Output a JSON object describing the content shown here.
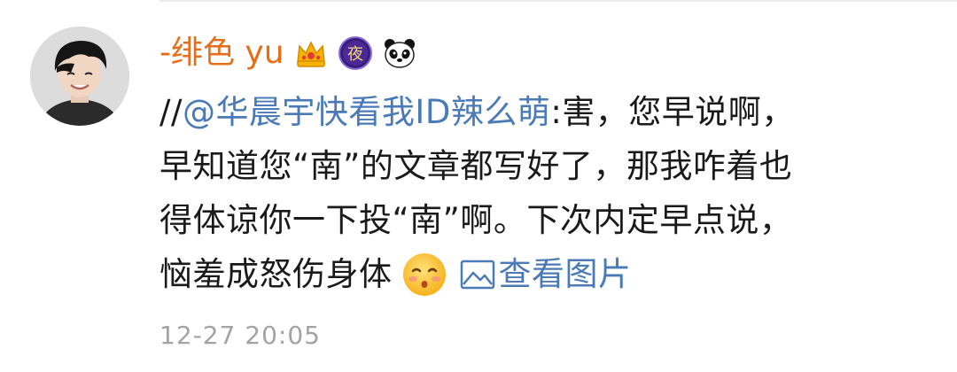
{
  "user": {
    "name": "-绯色 yu",
    "badges": [
      "crown-badge",
      "night-badge",
      "panda-badge"
    ],
    "night_badge_text": "夜",
    "username_color": "#e66e1a"
  },
  "post": {
    "repost_prefix": "//",
    "mention": "@华晨宇快看我ID辣么萌",
    "line1_rest": ":害，您早说啊，",
    "line2": "早知道您“南”的文章都写好了，那我咋着也",
    "line3": "得体谅你一下投“南”啊。下次内定早点说，",
    "line4": "恼羞成怒伤身体",
    "emoji": "kissing-face-emoji",
    "view_image_label": "查看图片",
    "mention_color": "#4a7bb7"
  },
  "timestamp": "12-27 20:05"
}
